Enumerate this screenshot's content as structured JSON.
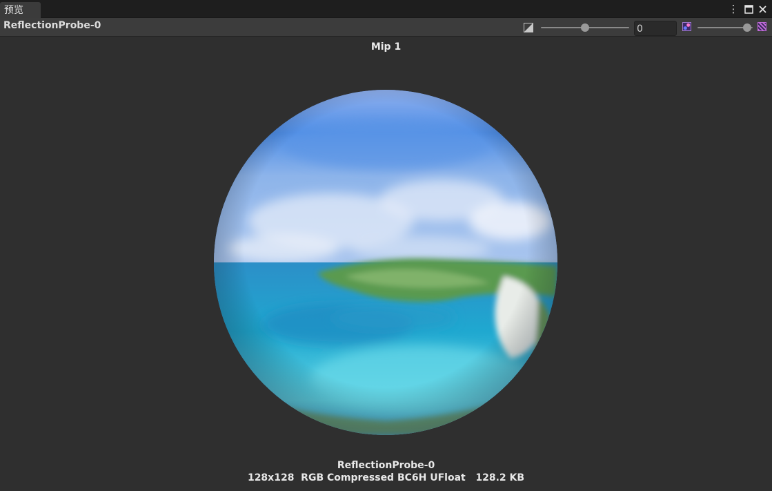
{
  "tab": {
    "label": "预览"
  },
  "header": {
    "title": "ReflectionProbe-0",
    "exposure_value": "0",
    "exposure_slider_value": 0.5,
    "mip_slider_value": 0.9
  },
  "preview": {
    "mip_label": "Mip 1",
    "asset_name": "ReflectionProbe-0",
    "details": "128x128  RGB Compressed BC6H UFloat   128.2 KB"
  },
  "icons": {
    "menu": "more-vertical-icon",
    "maximize": "maximize-icon",
    "close": "close-icon",
    "exposure": "exposure-icon",
    "mip_small": "mip-small-icon",
    "mip_large": "mip-large-icon"
  },
  "colors": {
    "background": "#2f2f2f",
    "header": "#3c3c3c",
    "tab_strip": "#1e1e1e"
  }
}
